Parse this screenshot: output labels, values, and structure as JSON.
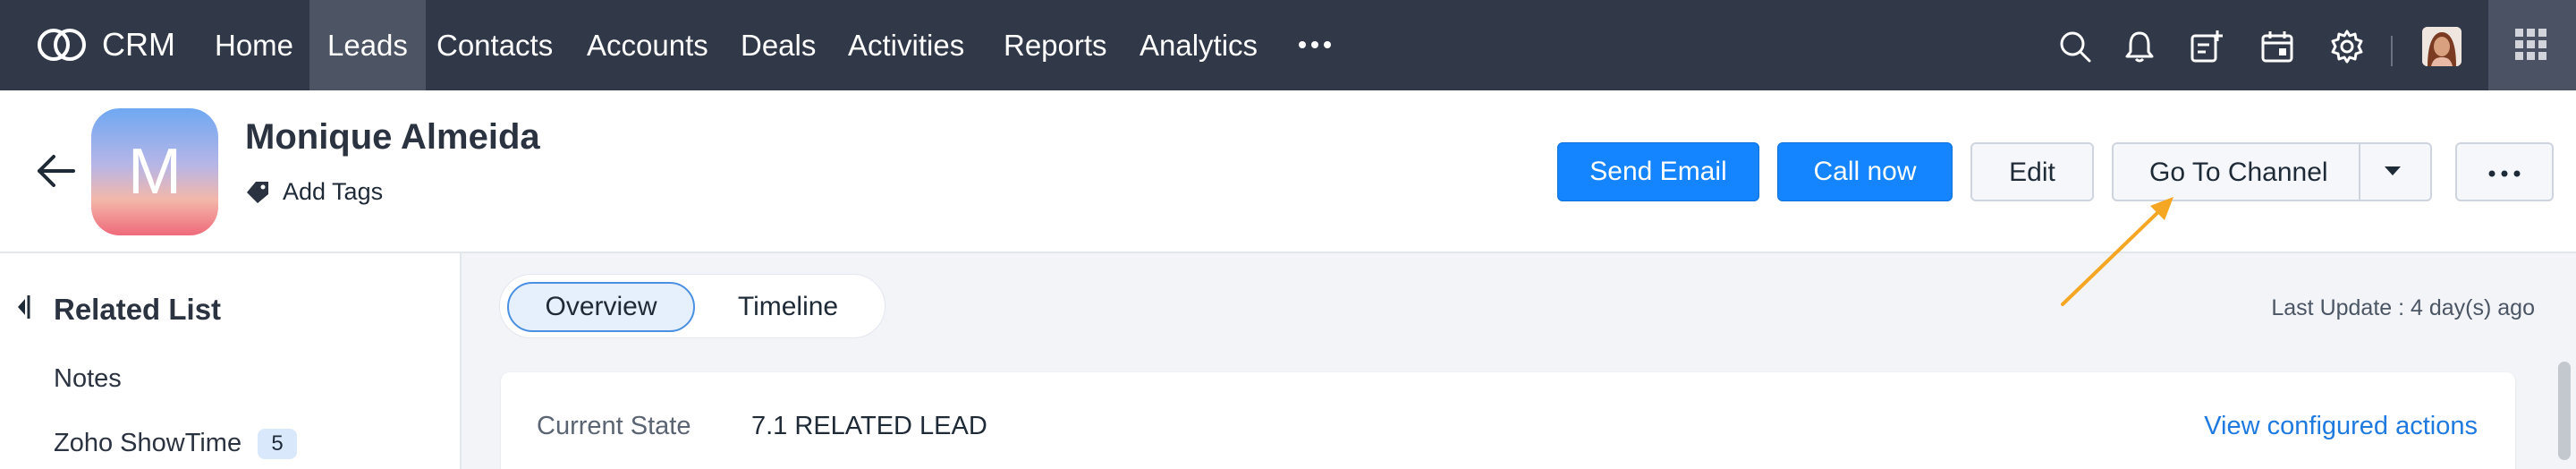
{
  "app": {
    "name": "CRM"
  },
  "nav": {
    "items": [
      {
        "label": "Home"
      },
      {
        "label": "Leads"
      },
      {
        "label": "Contacts"
      },
      {
        "label": "Accounts"
      },
      {
        "label": "Deals"
      },
      {
        "label": "Activities"
      },
      {
        "label": "Reports"
      },
      {
        "label": "Analytics"
      }
    ],
    "active": "Leads",
    "icons": [
      "more-icon",
      "search-icon",
      "bell-icon",
      "add-note-icon",
      "calendar-icon",
      "gear-icon",
      "user-avatar",
      "apps-grid-icon"
    ]
  },
  "record": {
    "avatar_letter": "M",
    "name": "Monique Almeida",
    "add_tags": "Add Tags"
  },
  "actions": {
    "send_email": "Send Email",
    "call_now": "Call now",
    "edit": "Edit",
    "go_to_channel": "Go To Channel"
  },
  "sidebar": {
    "title": "Related List",
    "items": [
      {
        "label": "Notes"
      },
      {
        "label": "Zoho ShowTime",
        "count": "5"
      }
    ]
  },
  "tabs": [
    {
      "label": "Overview"
    },
    {
      "label": "Timeline"
    }
  ],
  "last_update": "Last Update : 4 day(s) ago",
  "state": {
    "label": "Current State",
    "value": "7.1 RELATED LEAD",
    "view_actions": "View configured actions"
  },
  "colors": {
    "topbar": "#313949",
    "primary": "#1584ff",
    "link": "#1f7ae0",
    "annotation_arrow": "#f5a623"
  }
}
